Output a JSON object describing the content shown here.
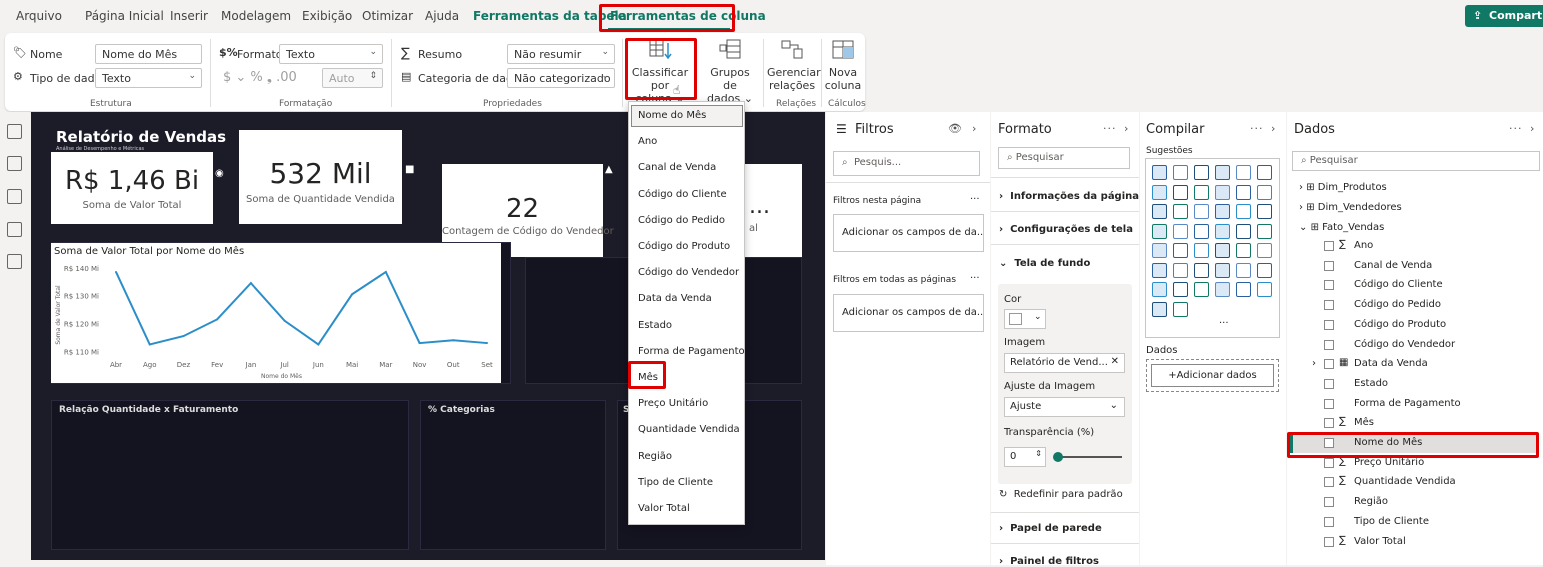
{
  "menubar": {
    "items": [
      "Arquivo",
      "Página Inicial",
      "Inserir",
      "Modelagem",
      "Exibição",
      "Otimizar",
      "Ajuda",
      "Ferramentas da tabela",
      "Ferramentas de coluna"
    ],
    "share": "Compartilhar"
  },
  "ribbon": {
    "estrutura": {
      "name_label": "Nome",
      "name_value": "Nome do Mês",
      "type_label": "Tipo de dados",
      "type_value": "Texto",
      "group": "Estrutura"
    },
    "formatacao": {
      "format_label": "Formato",
      "format_value": "Texto",
      "symbols": "$ ⌄ % ❟ .00",
      "auto_value": "Auto",
      "group": "Formatação"
    },
    "propriedades": {
      "summary_label": "Resumo",
      "summary_value": "Não resumir",
      "category_label": "Categoria de dados",
      "category_value": "Não categorizado",
      "group": "Propriedades"
    },
    "sort_button": [
      "Classificar por",
      "coluna ⌄"
    ],
    "groups_button": [
      "Grupos de",
      "dados ⌄"
    ],
    "relations_button": [
      "Gerenciar",
      "relações"
    ],
    "relations_group": "Relações",
    "newcol_button": [
      "Nova",
      "coluna"
    ],
    "calc_group": "Cálculos"
  },
  "report": {
    "title": "Relatório de Vendas",
    "subtitle": "Análise de Desempenho e Métricas",
    "card1_value": "R$ 1,46 Bi",
    "card1_label": "Soma de Valor Total",
    "card2_value": "532 Mil",
    "card2_label": "Soma de Quantidade Vendida",
    "card3_value": "22",
    "card3_label": "Contagem de Código do Vendedor",
    "card4_value": "...",
    "card4_label": "al",
    "panel1_label": "Relação Quantidade x Faturamento",
    "panel2_label": "% Categorias",
    "panel3_label": "So"
  },
  "chart_data": {
    "type": "line",
    "title": "Soma de Valor Total por Nome do Mês",
    "xlabel": "Nome do Mês",
    "ylabel": "Soma de Valor Total",
    "categories": [
      "Abr",
      "Ago",
      "Dez",
      "Fev",
      "Jan",
      "Jul",
      "Jun",
      "Mai",
      "Mar",
      "Nov",
      "Out",
      "Set"
    ],
    "values": [
      138.5,
      112.5,
      115.5,
      121.5,
      134.5,
      121,
      112.5,
      130.5,
      138.5,
      113,
      114,
      113
    ],
    "yticks": [
      "R$ 110 Mi",
      "R$ 120 Mi",
      "R$ 130 Mi",
      "R$ 140 Mi"
    ],
    "ytick_values": [
      110,
      120,
      130,
      140
    ],
    "ylim": [
      108,
      141
    ],
    "color": "#2c8ec9"
  },
  "dropdown": {
    "items": [
      "Nome do Mês",
      "Ano",
      "Canal de Venda",
      "Código do Cliente",
      "Código do Pedido",
      "Código do Produto",
      "Código do Vendedor",
      "Data da Venda",
      "Estado",
      "Forma de Pagamento",
      "Mês",
      "Preço Unitário",
      "Quantidade Vendida",
      "Região",
      "Tipo de Cliente",
      "Valor Total"
    ]
  },
  "filters": {
    "title": "Filtros",
    "search_placeholder": "Pesquis...",
    "on_page": "Filtros nesta página",
    "add_fields": "Adicionar os campos de da...",
    "all_pages": "Filtros em todas as páginas",
    "add_fields2": "Adicionar os campos de da..."
  },
  "format": {
    "title": "Formato",
    "search_placeholder": "Pesquisar",
    "sections": [
      "Informações da página",
      "Configurações de tela",
      "Tela de fundo"
    ],
    "cor_label": "Cor",
    "image_label": "Imagem",
    "image_value": "Relatório de Vend...",
    "fit_label": "Ajuste da Imagem",
    "fit_value": "Ajuste",
    "transparency_label": "Transparência (%)",
    "transparency_value": "0",
    "transparency_level": 0,
    "reset": "Redefinir para padrão",
    "wallpaper": "Papel de parede",
    "filters_panel": "Painel de filtros"
  },
  "build": {
    "title": "Compilar",
    "suggestions": "Sugestões",
    "data_label": "Dados",
    "add_data": "+Adicionar dados",
    "more": "..."
  },
  "data": {
    "title": "Dados",
    "search_placeholder": "Pesquisar",
    "tables": [
      "Dim_Produtos",
      "Dim_Vendedores",
      "Fato_Vendas"
    ],
    "fields": [
      {
        "name": "Ano",
        "sigma": "∑"
      },
      {
        "name": "Canal de Venda",
        "sigma": ""
      },
      {
        "name": "Código do Cliente",
        "sigma": ""
      },
      {
        "name": "Código do Pedido",
        "sigma": ""
      },
      {
        "name": "Código do Produto",
        "sigma": ""
      },
      {
        "name": "Código do Vendedor",
        "sigma": ""
      },
      {
        "name": "Data da Venda",
        "sigma": ""
      },
      {
        "name": "Estado",
        "sigma": ""
      },
      {
        "name": "Forma de Pagamento",
        "sigma": ""
      },
      {
        "name": "Mês",
        "sigma": "∑"
      },
      {
        "name": "Nome do Mês",
        "sigma": ""
      },
      {
        "name": "Preço Unitário",
        "sigma": "∑"
      },
      {
        "name": "Quantidade Vendida",
        "sigma": "∑"
      },
      {
        "name": "Região",
        "sigma": ""
      },
      {
        "name": "Tipo de Cliente",
        "sigma": ""
      },
      {
        "name": "Valor Total",
        "sigma": "∑"
      }
    ]
  },
  "colors": {
    "accent": "#117865",
    "highlight": "#e00000",
    "canvas": "#1c1b28"
  }
}
